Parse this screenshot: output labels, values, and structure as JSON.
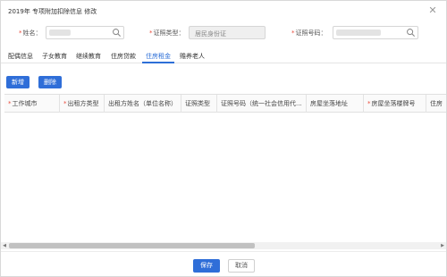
{
  "dialog": {
    "title": "2019年 专项附加扣除信息 修改",
    "close_glyph": "✕"
  },
  "form": {
    "name_label": "姓名：",
    "name_required": "*",
    "id_type_label": "证照类型：",
    "id_type_required": "*",
    "id_type_value": "居民身份证",
    "id_number_label": "证照号码：",
    "id_number_required": "*"
  },
  "tabs": [
    {
      "label": "配偶信息"
    },
    {
      "label": "子女教育"
    },
    {
      "label": "继续教育"
    },
    {
      "label": "住房贷款"
    },
    {
      "label": "住房租金",
      "active": true
    },
    {
      "label": "赡养老人"
    }
  ],
  "actions": {
    "add_label": "新增",
    "delete_label": "删除"
  },
  "table": {
    "columns": [
      {
        "label": "工作城市",
        "required": "*"
      },
      {
        "label": "出租方类型",
        "required": "*"
      },
      {
        "label": "出租方姓名（单位名称）",
        "required": ""
      },
      {
        "label": "证照类型",
        "required": ""
      },
      {
        "label": "证照号码（统一社会信用代...",
        "required": ""
      },
      {
        "label": "房屋坐落地址",
        "required": ""
      },
      {
        "label": "房屋坐落楼牌号",
        "required": "*"
      },
      {
        "label": "住房",
        "required": ""
      }
    ],
    "rows": []
  },
  "footer": {
    "save_label": "保存",
    "cancel_label": "取消"
  },
  "colors": {
    "accent": "#2f6ed8",
    "required": "#e94b3c"
  },
  "icons": {
    "search": "search-icon",
    "close": "close-icon"
  }
}
